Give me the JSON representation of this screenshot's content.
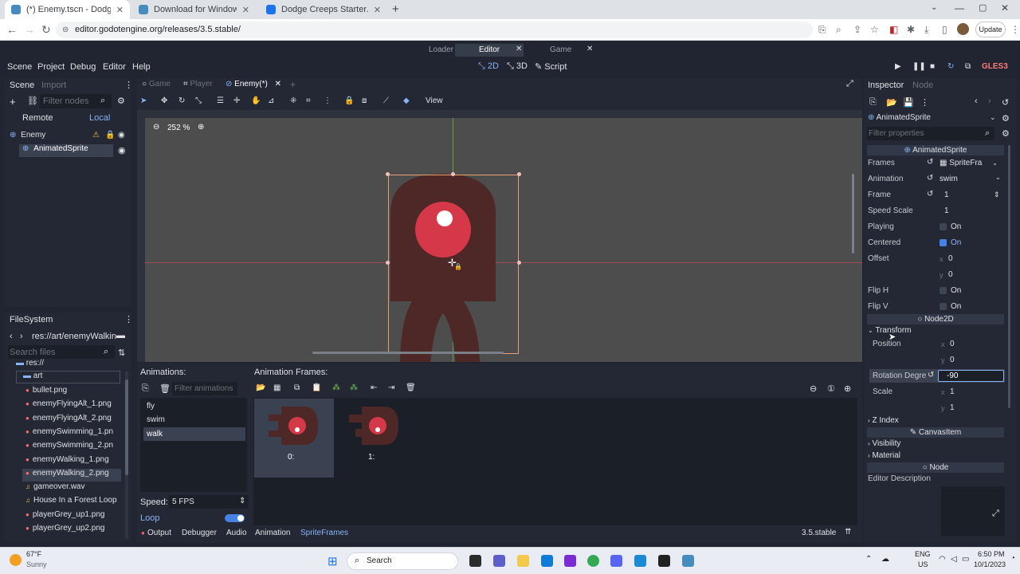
{
  "browser": {
    "tabs": [
      {
        "title": "(*) Enemy.tscn - Dodge Creeps S",
        "active": true,
        "color": "#478cbf"
      },
      {
        "title": "Download for Windows - Godot",
        "active": false,
        "color": "#478cbf"
      },
      {
        "title": "Dodge Creeps Starter.zip",
        "active": false,
        "color": "#1a73e8"
      }
    ],
    "url": "editor.godotengine.org/releases/3.5.stable/",
    "update_label": "Update"
  },
  "godot": {
    "top_tabs": [
      "Loader",
      "Editor",
      "Game"
    ],
    "menu": [
      "Scene",
      "Project",
      "Debug",
      "Editor",
      "Help"
    ],
    "modes": [
      "2D",
      "3D",
      "Script"
    ],
    "renderer": "GLES3",
    "scene_panel": {
      "tabs": [
        "Scene",
        "Import"
      ],
      "filter_placeholder": "Filter nodes",
      "remote": "Remote",
      "local": "Local",
      "nodes": [
        "Enemy",
        "AnimatedSprite"
      ]
    },
    "filesystem": {
      "title": "FileSystem",
      "path": "res://art/enemyWalkin",
      "search_placeholder": "Search files",
      "root": "res://",
      "folder": "art",
      "files": [
        "bullet.png",
        "enemyFlyingAlt_1.png",
        "enemyFlyingAlt_2.png",
        "enemySwimming_1.pn",
        "enemySwimming_2.pn",
        "enemyWalking_1.png",
        "enemyWalking_2.png",
        "gameover.wav",
        "House In a Forest Loop",
        "playerGrey_up1.png",
        "playerGrey_up2.png"
      ]
    },
    "scene_tabs": [
      "Game",
      "Player",
      "Enemy(*)"
    ],
    "viewport": {
      "zoom": "252 %",
      "view_menu": "View"
    },
    "animations": {
      "title": "Animations:",
      "filter_placeholder": "Filter animations",
      "items": [
        "fly",
        "swim",
        "walk"
      ],
      "selected": "walk",
      "speed_label": "Speed:",
      "speed_value": "5 FPS",
      "loop_label": "Loop"
    },
    "frames": {
      "title": "Animation Frames:",
      "items": [
        "0:",
        "1:"
      ]
    },
    "bottom_tabs": [
      "Output",
      "Debugger",
      "Audio",
      "Animation",
      "SpriteFrames"
    ],
    "version": "3.5.stable",
    "inspector": {
      "tabs": [
        "Inspector",
        "Node"
      ],
      "node": "AnimatedSprite",
      "filter_placeholder": "Filter properties",
      "class_header": "AnimatedSprite",
      "frames_label": "Frames",
      "frames_value": "SpriteFra",
      "animation_label": "Animation",
      "animation_value": "swim",
      "frame_label": "Frame",
      "frame_value": "1",
      "speed_label": "Speed Scale",
      "speed_value": "1",
      "playing_label": "Playing",
      "centered_label": "Centered",
      "on": "On",
      "offset_label": "Offset",
      "offset_x": "0",
      "offset_y": "0",
      "fliph_label": "Flip H",
      "flipv_label": "Flip V",
      "node2d": "Node2D",
      "transform": "Transform",
      "position_label": "Position",
      "pos_x": "0",
      "pos_y": "0",
      "rotation_label": "Rotation Degre",
      "rotation_value": "-90",
      "scale_label": "Scale",
      "scale_x": "1",
      "scale_y": "1",
      "zindex": "Z Index",
      "canvasitem": "CanvasItem",
      "visibility": "Visibility",
      "material": "Material",
      "node_section": "Node",
      "editor_desc": "Editor Description",
      "x": "x",
      "y": "y"
    }
  },
  "taskbar": {
    "weather_temp": "67°F",
    "weather_desc": "Sunny",
    "search": "Search",
    "lang": "ENG",
    "region": "US",
    "time": "6:50 PM",
    "date": "10/1/2023"
  }
}
